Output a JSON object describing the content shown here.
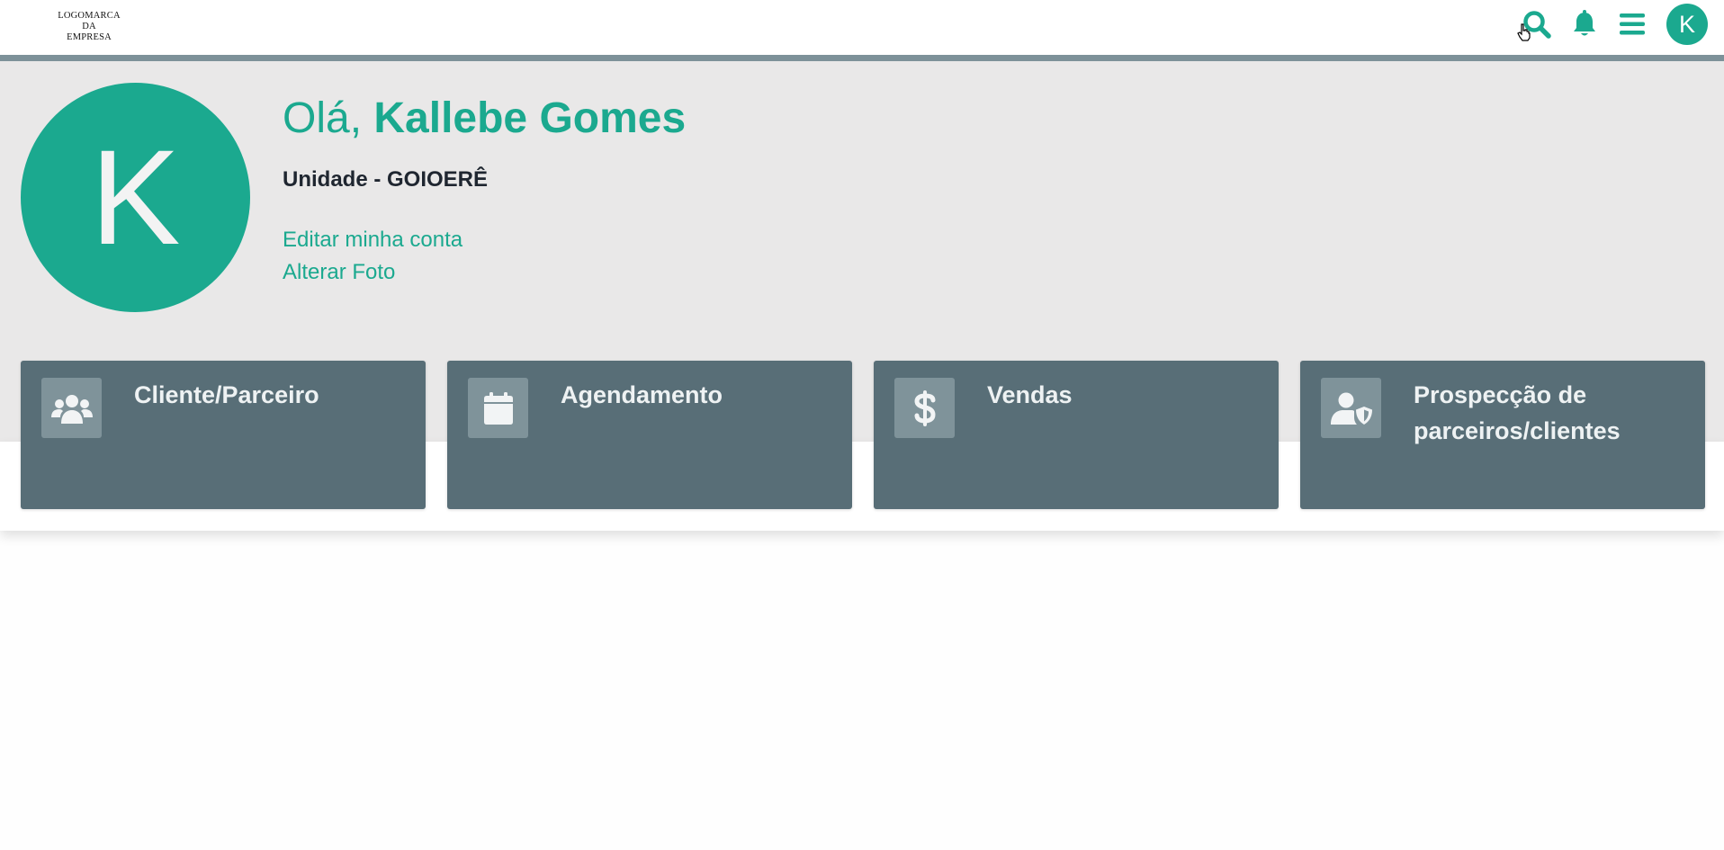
{
  "header": {
    "logo_lines": [
      "LOGOMARCA",
      "DA",
      "EMPRESA"
    ],
    "icons": {
      "search": "search-icon",
      "notifications": "bell-icon",
      "menu": "hamburger-menu-icon"
    },
    "avatar_initial": "K"
  },
  "profile": {
    "avatar_initial": "K",
    "greeting_prefix": "Olá, ",
    "user_name": "Kallebe Gomes",
    "unit": "Unidade - GOIOERÊ",
    "links": {
      "edit_account": "Editar minha conta",
      "change_photo": "Alterar Foto"
    }
  },
  "cards": [
    {
      "title": "Cliente/Parceiro",
      "icon": "users-group-icon"
    },
    {
      "title": "Agendamento",
      "icon": "calendar-icon"
    },
    {
      "title": "Vendas",
      "icon": "dollar-icon"
    },
    {
      "title": "Prospecção de parceiros/clientes",
      "icon": "user-shield-icon"
    }
  ],
  "colors": {
    "accent": "#1ba98f",
    "card_background": "#586e77",
    "card_icon_background": "#7f939a",
    "header_stripe": "#7d9199",
    "profile_band": "#e9e8e8"
  }
}
